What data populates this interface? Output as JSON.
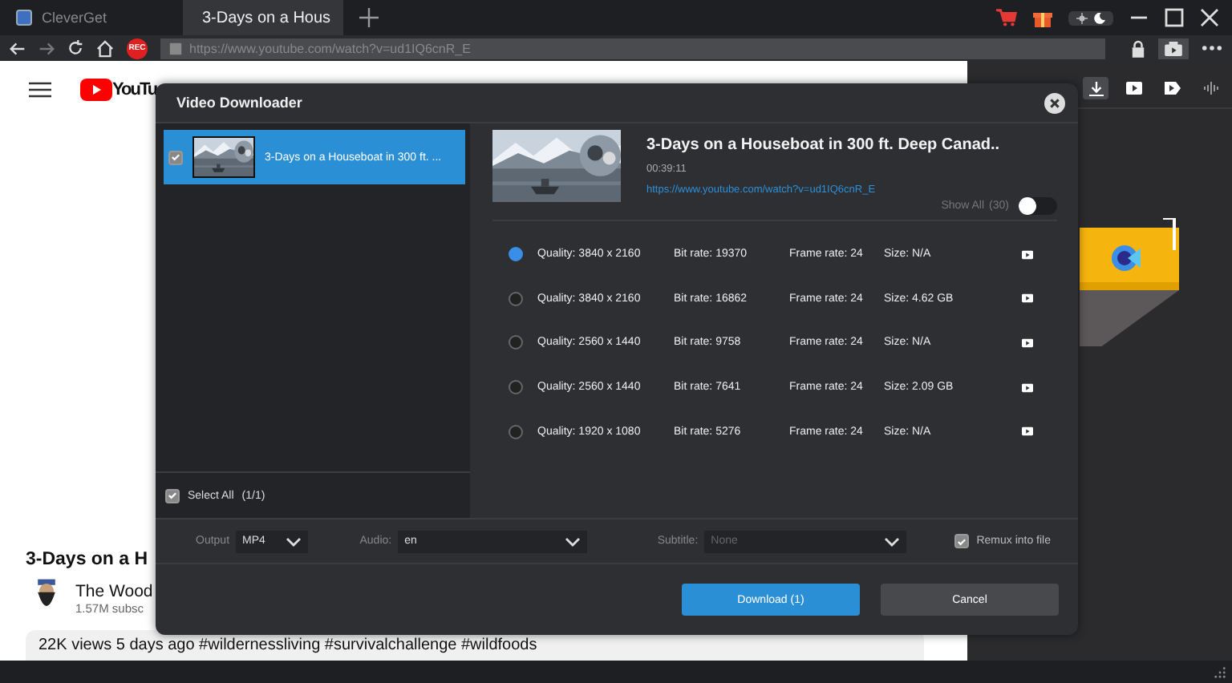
{
  "browser": {
    "tabs": [
      {
        "label": "CleverGet",
        "selected": false
      },
      {
        "label": "3-Days on a Hous",
        "selected": true
      }
    ],
    "rec_badge": "REC",
    "url": "https://www.youtube.com/watch?v=ud1IQ6cnR_E"
  },
  "page": {
    "logo": "YouTu",
    "video_title": "3-Days on a H",
    "channel": "The Wood",
    "subscribers": "1.57M subsc",
    "meta": "22K views  5 days ago  #wildernessliving #survivalchallenge #wildfoods"
  },
  "side_panel": {
    "tools": [
      {
        "kind": "download",
        "selected": true
      },
      {
        "kind": "video",
        "selected": false
      },
      {
        "kind": "record",
        "selected": false
      },
      {
        "kind": "audio",
        "selected": false
      }
    ]
  },
  "dialog": {
    "title": "Video Downloader",
    "items": [
      {
        "title": "3-Days on a Houseboat in 300 ft. ...",
        "selected": true,
        "checked": true
      }
    ],
    "select_all": {
      "label": "Select All",
      "count": "(1/1)",
      "checked": true
    },
    "video": {
      "title": "3-Days on a Houseboat in 300 ft. Deep Canad..",
      "duration": "00:39:11",
      "url": "https://www.youtube.com/watch?v=ud1IQ6cnR_E"
    },
    "show_all": {
      "label": "Show All",
      "count": "(30)",
      "on": false
    },
    "formats": [
      {
        "quality": "Quality: 3840 x 2160",
        "bitrate": "Bit rate: 19370",
        "framerate": "Frame rate: 24",
        "size": "Size: N/A",
        "selected": true
      },
      {
        "quality": "Quality: 3840 x 2160",
        "bitrate": "Bit rate: 16862",
        "framerate": "Frame rate: 24",
        "size": "Size: 4.62 GB",
        "selected": false
      },
      {
        "quality": "Quality: 2560 x 1440",
        "bitrate": "Bit rate: 9758",
        "framerate": "Frame rate: 24",
        "size": "Size: N/A",
        "selected": false
      },
      {
        "quality": "Quality: 2560 x 1440",
        "bitrate": "Bit rate: 7641",
        "framerate": "Frame rate: 24",
        "size": "Size: 2.09 GB",
        "selected": false
      },
      {
        "quality": "Quality: 1920 x 1080",
        "bitrate": "Bit rate: 5276",
        "framerate": "Frame rate: 24",
        "size": "Size: N/A",
        "selected": false
      }
    ],
    "output": {
      "label": "Output",
      "value": "MP4"
    },
    "audio": {
      "label": "Audio:",
      "value": "en"
    },
    "subtitle": {
      "label": "Subtitle:",
      "value": "None",
      "disabled": true
    },
    "remux": {
      "label": "Remux into file",
      "checked": true
    },
    "buttons": [
      {
        "label": "Download (1)",
        "kind": "primary"
      },
      {
        "label": "Cancel",
        "kind": "secondary"
      }
    ]
  }
}
